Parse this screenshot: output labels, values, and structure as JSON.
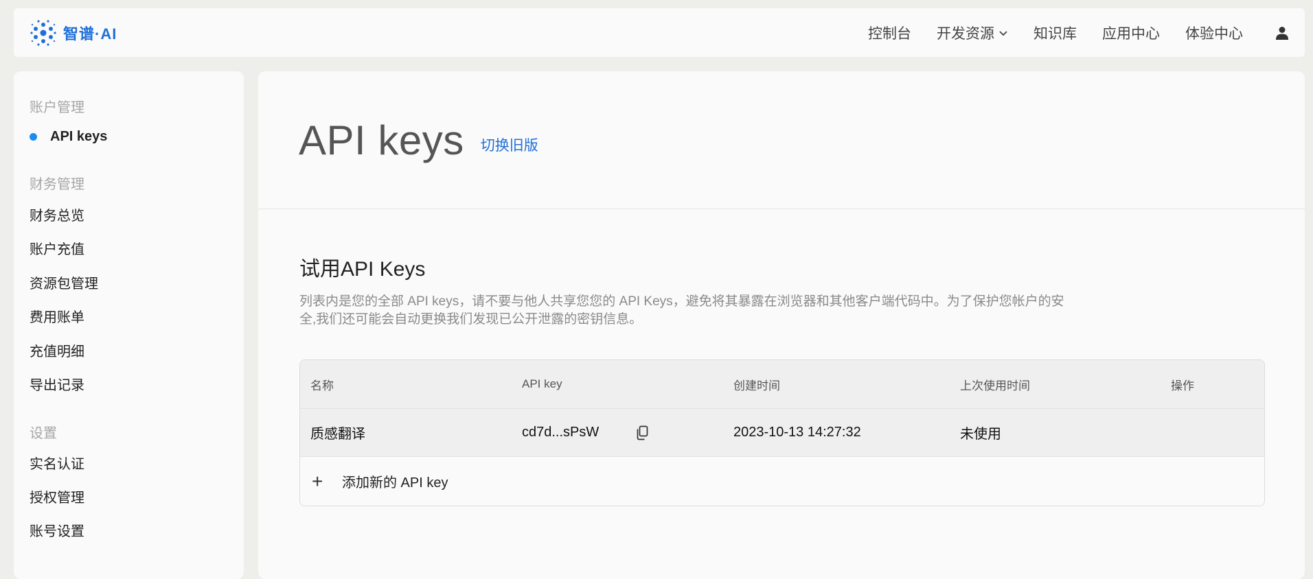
{
  "brand": {
    "name": "智谱·AI",
    "color": "#1f6fd9"
  },
  "nav": {
    "items": [
      {
        "label": "控制台"
      },
      {
        "label": "开发资源",
        "has_dropdown": true
      },
      {
        "label": "知识库"
      },
      {
        "label": "应用中心"
      },
      {
        "label": "体验中心"
      }
    ],
    "user_icon": "user-icon"
  },
  "sidebar": {
    "groups": [
      {
        "title": "账户管理",
        "items": [
          "API keys"
        ]
      },
      {
        "title": "财务管理",
        "items": [
          "财务总览",
          "账户充值",
          "资源包管理",
          "费用账单",
          "充值明细",
          "导出记录"
        ]
      },
      {
        "title": "设置",
        "items": [
          "实名认证",
          "授权管理",
          "账号设置"
        ]
      }
    ],
    "active_item": "API keys",
    "active_dot_color": "#1a8cf0"
  },
  "main": {
    "title": "API keys",
    "switch_link": "切换旧版",
    "section_title": "试用API Keys",
    "section_desc": "列表内是您的全部 API keys，请不要与他人共享您您的 API Keys，避免将其暴露在浏览器和其他客户端代码中。为了保护您帐户的安全,我们还可能会自动更换我们发现已公开泄露的密钥信息。",
    "table": {
      "headers": [
        "名称",
        "API key",
        "创建时间",
        "上次使用时间",
        "操作"
      ],
      "rows": [
        {
          "name": "质感翻译",
          "key": "cd7d...sPsW",
          "created": "2023-10-13 14:27:32",
          "last_used": "未使用"
        }
      ],
      "add_label": "添加新的 API key"
    }
  }
}
